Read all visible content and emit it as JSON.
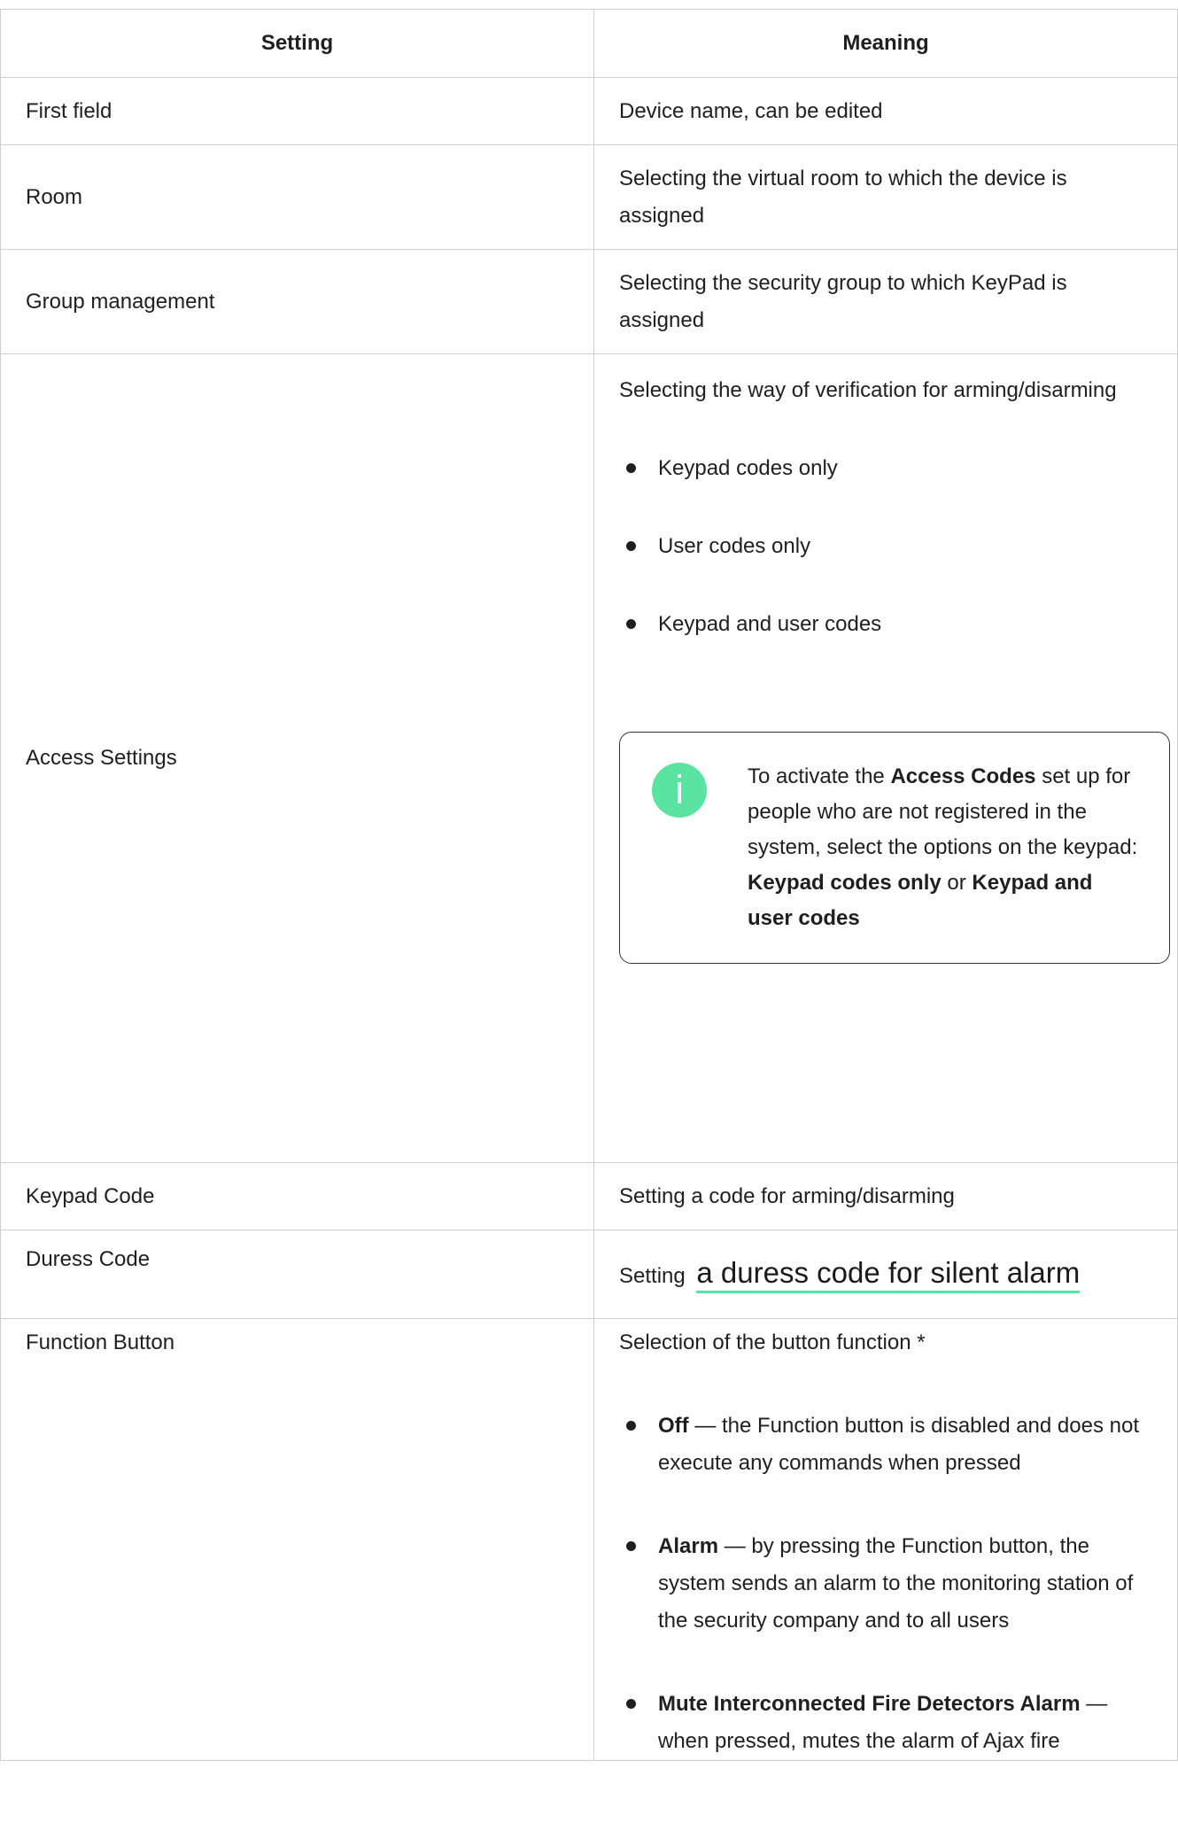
{
  "table": {
    "headers": {
      "setting": "Setting",
      "meaning": "Meaning"
    },
    "rows": {
      "first_field": {
        "setting": "First field",
        "meaning": "Device name, can be edited"
      },
      "room": {
        "setting": "Room",
        "meaning": "Selecting the virtual room to which the device is assigned"
      },
      "group": {
        "setting": "Group management",
        "meaning": "Selecting the security group to which KeyPad is assigned"
      },
      "access": {
        "setting": "Access Settings",
        "meaning_intro": "Selecting the way of verification for arming/disarming",
        "options": [
          "Keypad codes only",
          "User codes only",
          "Keypad and user codes"
        ],
        "callout": {
          "icon": "info-icon",
          "t1": "To activate the ",
          "b1": "Access Codes",
          "t2": " set up for people who are not registered in the system, select the options on the keypad: ",
          "b2": "Keypad codes only",
          "t3": " or ",
          "b3": "Keypad and user codes"
        }
      },
      "keypad_code": {
        "setting": "Keypad Code",
        "meaning": "Setting a code for arming/disarming"
      },
      "duress": {
        "setting": "Duress Code",
        "meaning_prefix": "Setting",
        "link": "a duress code for silent alarm"
      },
      "function": {
        "setting": "Function Button",
        "meaning_intro": "Selection of the button function *",
        "options": [
          {
            "term": "Off",
            "desc": " — the Function button is disabled and does not execute any commands when pressed"
          },
          {
            "term": "Alarm",
            "desc": " — by pressing the Function button, the system sends an alarm to the monitoring station of the security company and to all users"
          },
          {
            "term": "Mute Interconnected Fire Detectors Alarm",
            "desc": " — when pressed, mutes the alarm of Ajax fire"
          }
        ]
      }
    }
  },
  "colors": {
    "accent": "#5be3a2",
    "border": "#cfcfcf",
    "text": "#1f1f1f"
  }
}
